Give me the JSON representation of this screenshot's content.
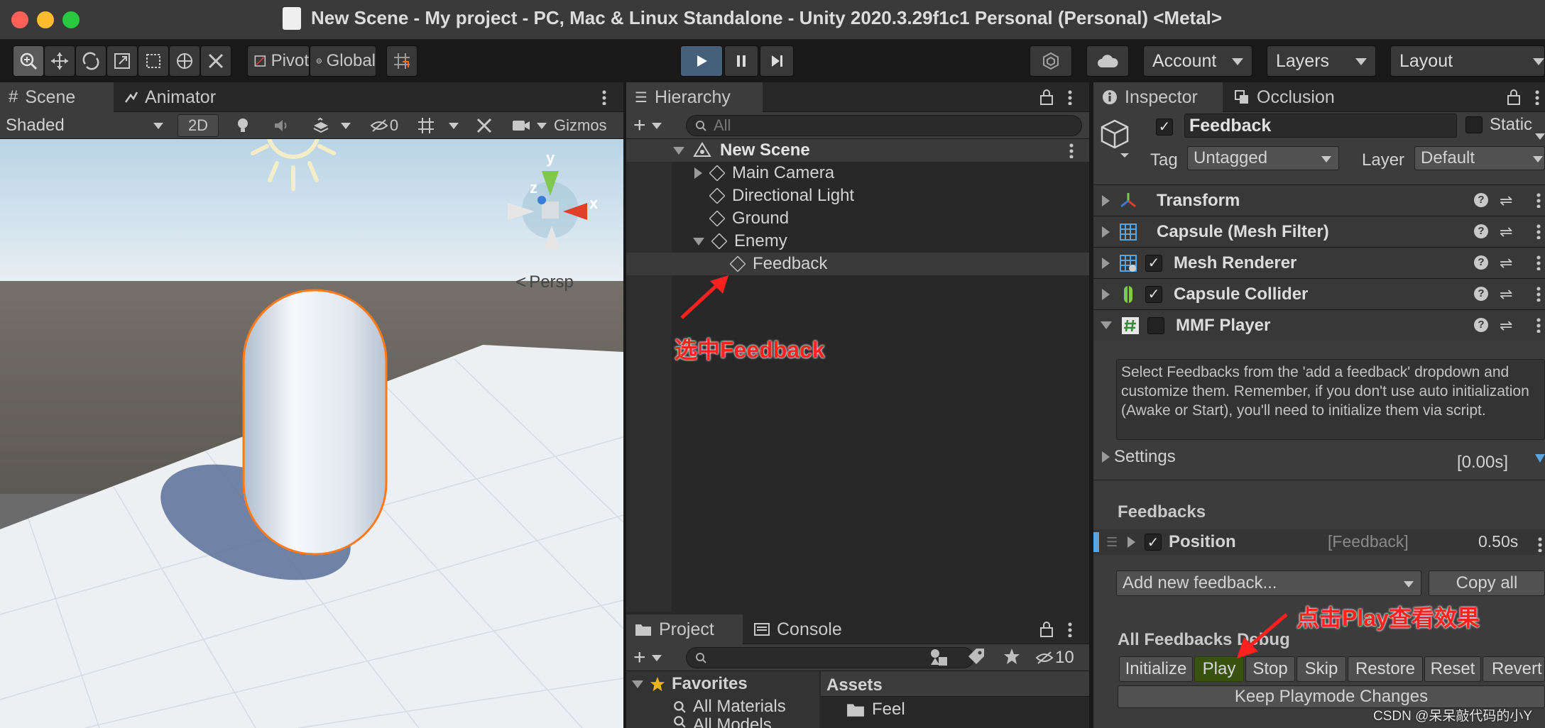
{
  "window": {
    "title": "New Scene - My project - PC, Mac & Linux Standalone - Unity 2020.3.29f1c1 Personal (Personal) <Metal>"
  },
  "toolbar": {
    "pivot_label": "Pivot",
    "global_label": "Global",
    "account_label": "Account",
    "layers_label": "Layers",
    "layout_label": "Layout"
  },
  "scene": {
    "tabs": [
      "Scene",
      "Animator"
    ],
    "shading_mode": "Shaded",
    "mode_2d": "2D",
    "hidden_count": "0",
    "gizmos_label": "Gizmos",
    "persp_label": "Persp",
    "axis_y": "y",
    "axis_x": "x",
    "axis_z": "z"
  },
  "hierarchy": {
    "tab": "Hierarchy",
    "search_placeholder": "All",
    "scene_name": "New Scene",
    "items": [
      "Main Camera",
      "Directional Light",
      "Ground",
      "Enemy",
      "Feedback"
    ]
  },
  "project": {
    "tabs": [
      "Project",
      "Console"
    ],
    "hidden_count": "10",
    "favorites_label": "Favorites",
    "favorites": [
      "All Materials",
      "All Models"
    ],
    "assets_label": "Assets",
    "folders": [
      "Feel"
    ]
  },
  "inspector": {
    "tabs": [
      "Inspector",
      "Occlusion"
    ],
    "object_name": "Feedback",
    "static_label": "Static",
    "tag_label": "Tag",
    "tag_value": "Untagged",
    "layer_label": "Layer",
    "layer_value": "Default",
    "components": [
      "Transform",
      "Capsule (Mesh Filter)",
      "Mesh Renderer",
      "Capsule Collider",
      "MMF Player"
    ],
    "help_text": "Select Feedbacks from the 'add a feedback' dropdown and customize them. Remember, if you don't use auto initialization (Awake or Start), you'll need to initialize them via script.",
    "settings_label": "Settings",
    "settings_duration": "[0.00s]",
    "feedbacks_label": "Feedbacks",
    "feedback_item": {
      "name": "Position",
      "type": "[Feedback]",
      "duration": "0.50s"
    },
    "add_feedback_label": "Add new feedback...",
    "copy_all_label": "Copy all",
    "debug_label": "All Feedbacks Debug",
    "debug_buttons": [
      "Initialize",
      "Play",
      "Stop",
      "Skip",
      "Restore",
      "Reset",
      "Revert"
    ],
    "keep_changes_label": "Keep Playmode Changes"
  },
  "annotations": {
    "select_feedback": "选中Feedback",
    "click_play": "点击Play查看效果",
    "watermark": "CSDN @呆呆敲代码的小Y"
  },
  "colors": {
    "accent_play": "#46607c",
    "annotation_red": "#ff2020",
    "capsule_outline": "#ff7a1a"
  }
}
